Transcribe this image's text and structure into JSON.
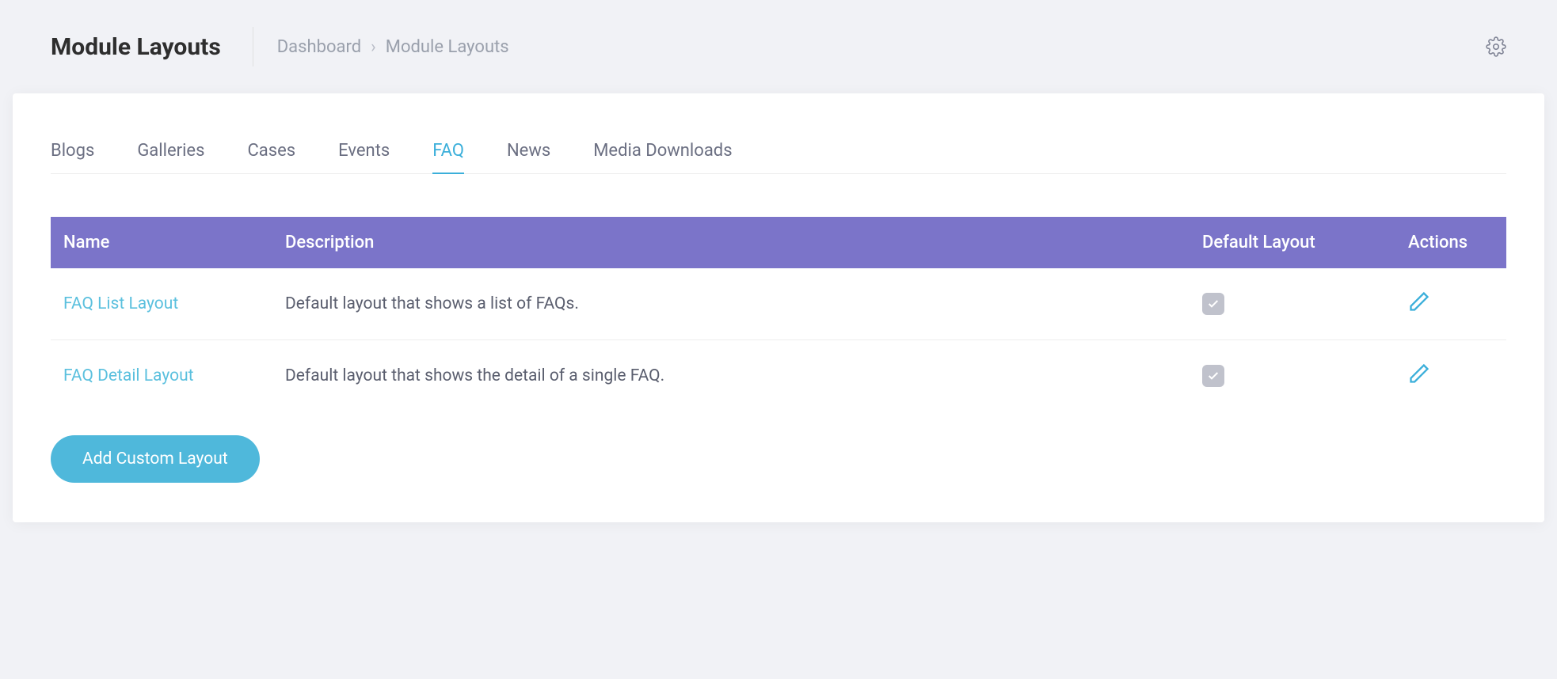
{
  "header": {
    "title": "Module Layouts",
    "breadcrumb": {
      "root": "Dashboard",
      "current": "Module Layouts"
    }
  },
  "tabs": [
    {
      "label": "Blogs",
      "active": false
    },
    {
      "label": "Galleries",
      "active": false
    },
    {
      "label": "Cases",
      "active": false
    },
    {
      "label": "Events",
      "active": false
    },
    {
      "label": "FAQ",
      "active": true
    },
    {
      "label": "News",
      "active": false
    },
    {
      "label": "Media Downloads",
      "active": false
    }
  ],
  "table": {
    "headers": {
      "name": "Name",
      "description": "Description",
      "default_layout": "Default Layout",
      "actions": "Actions"
    },
    "rows": [
      {
        "name": "FAQ List Layout",
        "description": "Default layout that shows a list of FAQs.",
        "default": true
      },
      {
        "name": "FAQ Detail Layout",
        "description": "Default layout that shows the detail of a single FAQ.",
        "default": true
      }
    ]
  },
  "buttons": {
    "add_custom_layout": "Add Custom Layout"
  }
}
